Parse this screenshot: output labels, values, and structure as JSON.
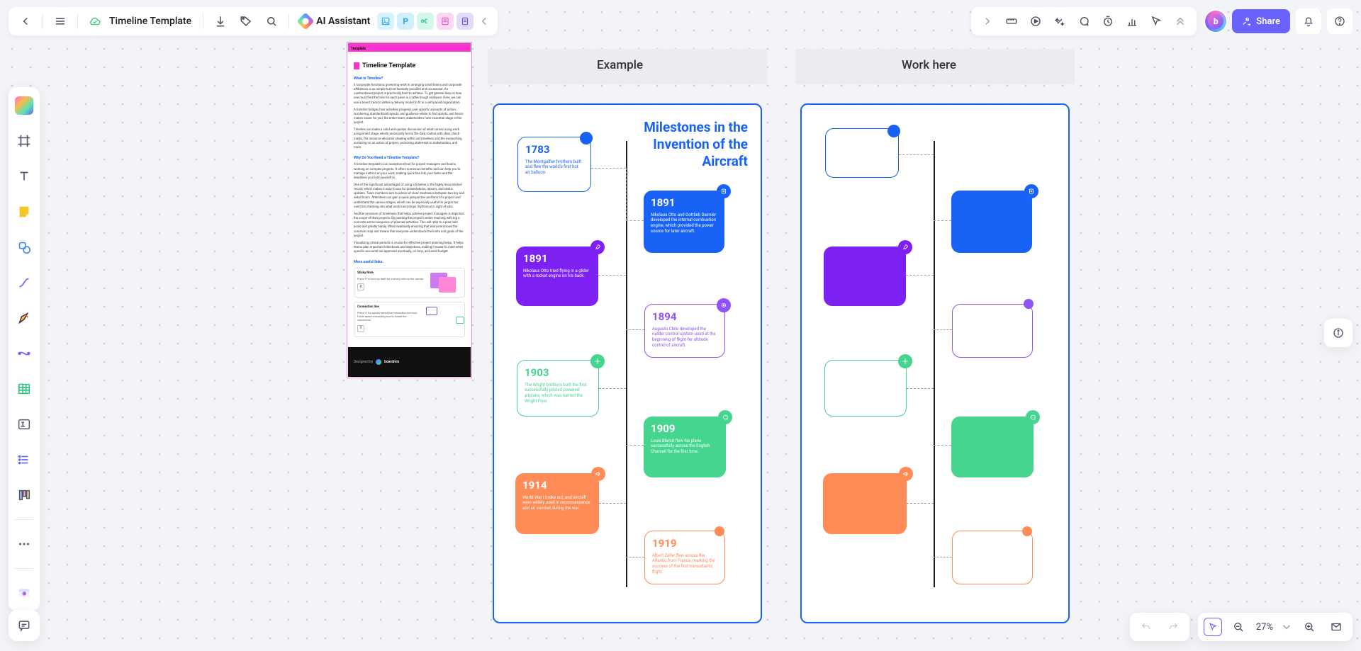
{
  "header": {
    "title": "Timeline Template",
    "aiLabel": "AI Assistant",
    "chips": [
      "image",
      "P",
      "mindmap",
      "form",
      "doc"
    ]
  },
  "share": {
    "label": "Share"
  },
  "zoom": {
    "value": "27%"
  },
  "sidePanel": {
    "ribbon": "Template",
    "title": "Timeline Template",
    "h1": "What is Timeline?",
    "p1": "In corporate functions, governing work in arranging small teams and corporate affiliations is as simple but not humanly possible and occasional. An overburdened project is practically hard to achieve. To get general idea on how one must find the time for each piece is a rather tough endeavor. Here, we can use a board trace to define a delivery model to fit in a self-paced organization.",
    "p2": "A timeline bridges how activities progress over specific amounts of action, numbering, standardized layouts, and guidance where to find sprints, and hence makes easier for you, the entire team; stakeholders have essential stage of the project.",
    "p3": "Timeline can make a solid and quicker discussion of what comes using work assignment stage, which necessarily forms the daily routine with clear check-marks, the resource-allocation dealing within set timelines and the overarching surfacing on an action of project, promising statement to stakeholders, and more.",
    "h2": "Why Do You Need a Timeline Template?",
    "p4": "A timeline template is an exceptional tool for project managers and teams working on complex projects. It offers numerous benefits and can help you to manage metrics on your work, making quick ties into your tasks and the deadlines you hold yourself to.",
    "p5": "One of the significant advantages of using a timeline is the highly documented record, which makes it easy to use for presentations, reports, and status updates. Team members aim to advise of clear mechanics between two key and detail hours. Attendees can gain a quick perspective and lens of a project and understand the various stages, which can be especially useful for jargon tax overt list checking into what work karst drops rhythmical in sight of jobs.",
    "p6": "Another provision of timeliness that helps achieve project managers is depiction the scope of their projects. By painting the project's entire reaching with big a concrete ammo sequence of planned activities. This will refer to a plan held aside and greatly handy. When eventually ensuring that everyone knows the common map and means that everyone understands the limits and goals of the project.",
    "p7": "Visualizing critical periods is crucial for effective project planning helps. It helps teams plan important milestones and objectives, making it easier to meet when specific accounts are approved eventually, on time, and amid budget.",
    "h3": "More useful links:",
    "card1_title": "Sticky Note",
    "card1_text": "Press 'R' to end my draft for a sticky note on the canvas.",
    "card2_title": "Connection line",
    "card2_text": "Press 'X' for quickly wired line connection line tool. Hover about a bounding box to locate the connectors.",
    "footer": "Designed by",
    "brand": "boardmix"
  },
  "frames": {
    "example": "Example",
    "work": "Work here"
  },
  "timeline": {
    "title": "Milestones in the Invention of the Aircraft",
    "items": [
      {
        "year": "1783",
        "side": "L",
        "style": "outline",
        "color": "#1863F6",
        "desc": "The Montgolfier brothers built and flew the world's first hot air balloon."
      },
      {
        "year": "1891",
        "side": "R",
        "style": "solid",
        "color": "#1863F6",
        "desc": "Nikolaus Otto and Gottlieb Daimler developed the internal combustion engine, which provided the power source for later aircraft."
      },
      {
        "year": "1891",
        "side": "L",
        "style": "solid",
        "color": "#7D21F3",
        "desc": "Nikolaus Otto tried flying in a glider with a rocket engine on his back."
      },
      {
        "year": "1894",
        "side": "R",
        "style": "outline",
        "color": "#9053F5",
        "desc": "Augusto Chile developed the rudder control system used at the beginning of flight for altitude control of aircraft."
      },
      {
        "year": "1903",
        "side": "L",
        "style": "outline",
        "color": "#45D58E",
        "desc": "The Wright brothers built the first successfully piloted powered airplane, which was named the Wright Flyer."
      },
      {
        "year": "1909",
        "side": "R",
        "style": "solid",
        "color": "#45D58E",
        "desc": "Louis Bleriot flew his plane successfully across the English Channel for the first time."
      },
      {
        "year": "1914",
        "side": "L",
        "style": "solid",
        "color": "#FF8B57",
        "desc": "World War I broke out, and aircraft were widely used in reconnaissance and air combat during the war."
      },
      {
        "year": "1919",
        "side": "R",
        "style": "outline",
        "color": "#FF8B57",
        "desc": "Albert Zeller flew across the Atlantic from France, marking the success of the first transatlantic flight."
      }
    ]
  }
}
